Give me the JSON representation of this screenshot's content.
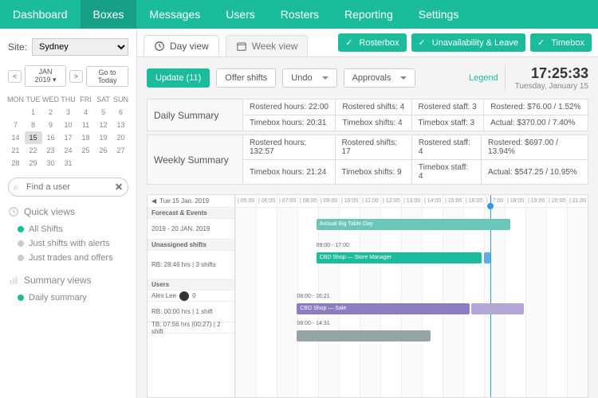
{
  "nav": {
    "items": [
      "Dashboard",
      "Boxes",
      "Messages",
      "Users",
      "Rosters",
      "Reporting",
      "Settings"
    ],
    "active": 1
  },
  "site": {
    "label": "Site:",
    "value": "Sydney"
  },
  "calendar": {
    "month": "JAN 2019",
    "go_today": "Go to Today",
    "dow": [
      "MON",
      "TUE",
      "WED",
      "THU",
      "FRI",
      "SAT",
      "SUN"
    ],
    "today": 15
  },
  "search": {
    "placeholder": "Find a user"
  },
  "quick": {
    "title": "Quick views",
    "items": [
      {
        "label": "All Shifts",
        "on": true
      },
      {
        "label": "Just shifts with alerts",
        "on": false
      },
      {
        "label": "Just trades and offers",
        "on": false
      }
    ]
  },
  "sumviews": {
    "title": "Summary views",
    "items": [
      {
        "label": "Daily summary",
        "on": true
      }
    ]
  },
  "tabs": {
    "day": "Day view",
    "week": "Week view"
  },
  "actions": {
    "rosterbox": "Rosterbox",
    "unavail": "Unavailability & Leave",
    "timebox": "Timebox"
  },
  "toolbar": {
    "update": "Update (11)",
    "offer": "Offer shifts",
    "undo": "Undo",
    "approvals": "Approvals",
    "legend": "Legend"
  },
  "clock": {
    "time": "17:25:33",
    "date": "Tuesday, January 15"
  },
  "daily": {
    "title": "Daily Summary",
    "r1": [
      "Rostered hours: 22:00",
      "Rostered shifts: 4",
      "Rostered staff: 3",
      "Rostered: $76.00 / 1.52%"
    ],
    "r2": [
      "Timebox hours: 20:31",
      "Timebox shifts: 4",
      "Timebox staff: 3",
      "Actual: $370.00 / 7.40%"
    ]
  },
  "weekly": {
    "title": "Weekly Summary",
    "r1": [
      "Rostered hours: 132:57",
      "Rostered shifts: 17",
      "Rostered staff: 4",
      "Rostered: $697.00 / 13.94%"
    ],
    "r2": [
      "Timebox hours: 21:24",
      "Timebox shifts: 9",
      "Timebox staff: 4",
      "Actual: $547.25 / 10.95%"
    ]
  },
  "gantt": {
    "date_label": "Tue 15 Jan. 2019",
    "hours": [
      "05:00",
      "06:00",
      "07:00",
      "08:00",
      "09:00",
      "10:00",
      "11:00",
      "12:00",
      "13:00",
      "14:00",
      "15:00",
      "16:00",
      "17:00",
      "18:00",
      "19:00",
      "20:00",
      "21:00"
    ],
    "forecast_title": "Forecast & Events",
    "forecast_range": "2019 - 20 JAN. 2019",
    "event_label": "Annual Big Table Day",
    "unassigned_title": "Unassigned shifts",
    "unassigned_sub": "RB: 28:46 hrs | 3 shifts",
    "shift1_time": "09:00 - 17:00",
    "shift1_label": "CBD Shop — Store Manager ",
    "users_title": "Users",
    "user1_name": "Alex Lee",
    "user1_badge": "0",
    "user1_rb": "RB: 00:00 hrs | 1 shift",
    "user1_shift": "08:00 - 16:21",
    "user1_label": "CBD Shop — Sale ",
    "user2_tb": "TB: 07:56 hrs (00:27) | 2 shift",
    "user2_shift": "08:00 - 14:31"
  }
}
